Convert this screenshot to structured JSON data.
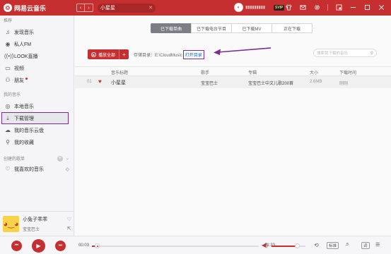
{
  "app": {
    "title": "网易云音乐"
  },
  "header": {
    "search_value": "小星星",
    "username": "▮▮▮▮▮▮▮▮▮",
    "vip": "SVIP",
    "icons": [
      "shirt-icon",
      "mail-icon",
      "gear-icon",
      "mini-mode-icon",
      "minimize-icon",
      "maximize-icon",
      "close-icon"
    ]
  },
  "sidebar": {
    "recommend_title": "推荐",
    "recommend_items": [
      {
        "label": "发现音乐",
        "icon": "note-icon"
      },
      {
        "label": "私人FM",
        "icon": "radio-icon"
      },
      {
        "label": "LOOK直播",
        "icon": "live-icon"
      },
      {
        "label": "视频",
        "icon": "video-icon"
      },
      {
        "label": "朋友",
        "icon": "friends-icon"
      }
    ],
    "my_music_title": "我的音乐",
    "my_music_items": [
      {
        "label": "本地音乐",
        "icon": "local-music-icon"
      },
      {
        "label": "下载管理",
        "icon": "download-icon",
        "active": true
      },
      {
        "label": "我的音乐云盘",
        "icon": "cloud-icon"
      },
      {
        "label": "我的收藏",
        "icon": "collection-icon"
      }
    ],
    "created_title": "创建的歌单",
    "liked_playlist": "我喜欢的音乐"
  },
  "now_playing": {
    "title": "小兔子乖乖",
    "artist": "宝宝巴士"
  },
  "tabs": [
    {
      "label": "已下载单曲",
      "active": true
    },
    {
      "label": "已下载电台节目",
      "active": false
    },
    {
      "label": "已下载MV",
      "active": false
    },
    {
      "label": "正在下载",
      "active": false
    }
  ],
  "toolbar": {
    "play_all": "播放全部",
    "storage_label": "存储目录：E:\\CloudMusic",
    "open_dir": "打开目录",
    "search_placeholder": "搜索我下载的音乐"
  },
  "table": {
    "headers": [
      "音乐标题",
      "歌手",
      "专辑",
      "大小",
      "下载时间"
    ],
    "rows": [
      {
        "index": "01",
        "title": "小星星",
        "artist": "宝宝巴士",
        "album": "宝宝巴士中文儿歌200首",
        "size": "2.6MB",
        "time": "刚刚"
      }
    ]
  },
  "player": {
    "current_time": "00:03",
    "total_time": "01:33",
    "progress": 0.02,
    "volume": 0.75,
    "quality": "标准",
    "lyrics": "词"
  },
  "colors": {
    "brand": "#c62f2f",
    "annotation": "#7b2d8f",
    "link": "#0c73c2"
  }
}
